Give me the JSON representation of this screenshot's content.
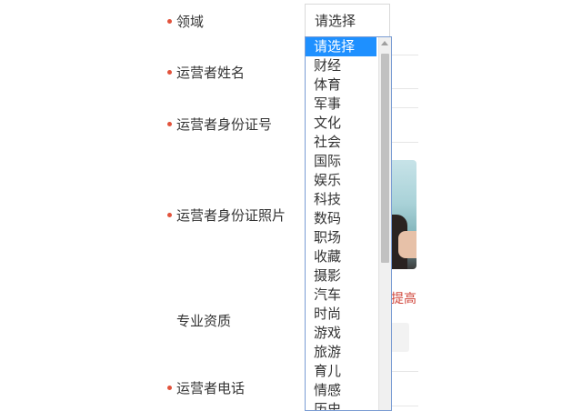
{
  "form": {
    "labels": [
      {
        "text": "领域",
        "required": true
      },
      {
        "text": "运营者姓名",
        "required": true
      },
      {
        "text": "运营者身份证号",
        "required": true
      },
      {
        "text": "运营者身份证照片",
        "required": true
      },
      {
        "text": "专业资质",
        "required": false
      },
      {
        "text": "运营者电话",
        "required": true
      }
    ],
    "domain_select": {
      "selected_value": "请选择",
      "options": [
        "请选择",
        "财经",
        "体育",
        "军事",
        "文化",
        "社会",
        "国际",
        "娱乐",
        "科技",
        "数码",
        "职场",
        "收藏",
        "摄影",
        "汽车",
        "时尚",
        "游戏",
        "旅游",
        "育儿",
        "情感",
        "历史"
      ],
      "highlighted_index": 0
    },
    "photo_hint": "提高"
  },
  "colors": {
    "required_dot": "#e2533c",
    "option_highlight": "#1e90ff",
    "dropdown_border": "#7a9cd3",
    "hint_red": "#d0453a"
  }
}
